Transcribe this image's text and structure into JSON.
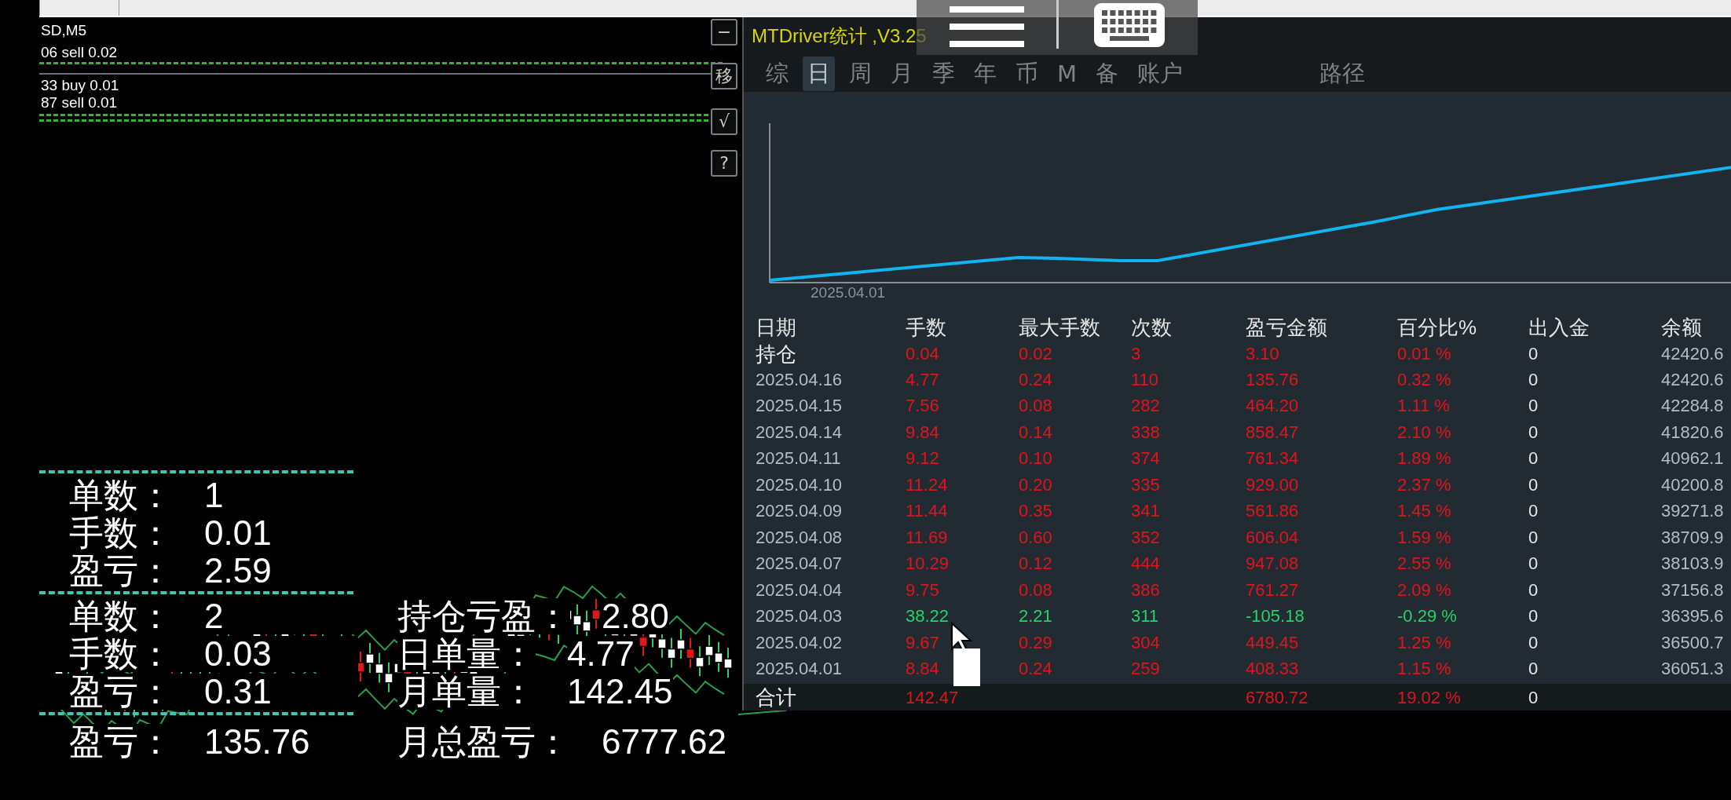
{
  "chart": {
    "symbol": "SD,M5",
    "orders": [
      {
        "label": "06 sell 0.02"
      },
      {
        "label": "33 buy 0.01"
      },
      {
        "label": "87 sell 0.01"
      }
    ],
    "side_buttons": [
      "−",
      "移",
      "√",
      "?"
    ]
  },
  "stats": {
    "group_1": [
      {
        "label": "单数：",
        "value": "1"
      },
      {
        "label": "手数：",
        "value": "0.01"
      },
      {
        "label": "盈亏：",
        "value": "2.59"
      }
    ],
    "group_2": [
      {
        "label": "单数：",
        "value": "2"
      },
      {
        "label": "手数：",
        "value": "0.03"
      },
      {
        "label": "盈亏：",
        "value": "0.31"
      }
    ],
    "group_2_right": [
      {
        "label": "持仓亏盈：",
        "value": "2.80"
      },
      {
        "label": "日单量：",
        "value": "4.77"
      },
      {
        "label": "月单量：",
        "value": "142.45"
      }
    ],
    "totals": [
      {
        "label": "盈亏：",
        "value": "135.76"
      },
      {
        "label": "月总盈亏：",
        "value": "6777.62"
      }
    ]
  },
  "panel": {
    "title": "MTDriver统计 ,V3.25",
    "tabs": [
      {
        "label": "综",
        "selected": false
      },
      {
        "label": "日",
        "selected": true
      },
      {
        "label": "周",
        "selected": false
      },
      {
        "label": "月",
        "selected": false
      },
      {
        "label": "季",
        "selected": false
      },
      {
        "label": "年",
        "selected": false
      },
      {
        "label": "币",
        "selected": false
      },
      {
        "label": "M",
        "selected": false
      },
      {
        "label": "备",
        "selected": false
      },
      {
        "label": "账户",
        "selected": false
      }
    ],
    "path_label": "路径",
    "equity_chart": {
      "date_label": "2025.04.01"
    },
    "table": {
      "columns": [
        "日期",
        "手数",
        "最大手数",
        "次数",
        "盈亏金额",
        "百分比%",
        "出入金",
        "余额"
      ],
      "rows": [
        {
          "kind": "position",
          "date": "持仓",
          "lots": "0.04",
          "max_lots": "0.02",
          "count": "3",
          "pl": "3.10",
          "pct": "0.01 %",
          "flow": "0",
          "balance": "42420.6",
          "loss": false
        },
        {
          "kind": "day",
          "date": "2025.04.16",
          "lots": "4.77",
          "max_lots": "0.24",
          "count": "110",
          "pl": "135.76",
          "pct": "0.32 %",
          "flow": "0",
          "balance": "42420.6",
          "loss": false
        },
        {
          "kind": "day",
          "date": "2025.04.15",
          "lots": "7.56",
          "max_lots": "0.08",
          "count": "282",
          "pl": "464.20",
          "pct": "1.11 %",
          "flow": "0",
          "balance": "42284.8",
          "loss": false
        },
        {
          "kind": "day",
          "date": "2025.04.14",
          "lots": "9.84",
          "max_lots": "0.14",
          "count": "338",
          "pl": "858.47",
          "pct": "2.10 %",
          "flow": "0",
          "balance": "41820.6",
          "loss": false
        },
        {
          "kind": "day",
          "date": "2025.04.11",
          "lots": "9.12",
          "max_lots": "0.10",
          "count": "374",
          "pl": "761.34",
          "pct": "1.89 %",
          "flow": "0",
          "balance": "40962.1",
          "loss": false
        },
        {
          "kind": "day",
          "date": "2025.04.10",
          "lots": "11.24",
          "max_lots": "0.20",
          "count": "335",
          "pl": "929.00",
          "pct": "2.37 %",
          "flow": "0",
          "balance": "40200.8",
          "loss": false
        },
        {
          "kind": "day",
          "date": "2025.04.09",
          "lots": "11.44",
          "max_lots": "0.35",
          "count": "341",
          "pl": "561.86",
          "pct": "1.45 %",
          "flow": "0",
          "balance": "39271.8",
          "loss": false
        },
        {
          "kind": "day",
          "date": "2025.04.08",
          "lots": "11.69",
          "max_lots": "0.60",
          "count": "352",
          "pl": "606.04",
          "pct": "1.59 %",
          "flow": "0",
          "balance": "38709.9",
          "loss": false
        },
        {
          "kind": "day",
          "date": "2025.04.07",
          "lots": "10.29",
          "max_lots": "0.12",
          "count": "444",
          "pl": "947.08",
          "pct": "2.55 %",
          "flow": "0",
          "balance": "38103.9",
          "loss": false
        },
        {
          "kind": "day",
          "date": "2025.04.04",
          "lots": "9.75",
          "max_lots": "0.08",
          "count": "386",
          "pl": "761.27",
          "pct": "2.09 %",
          "flow": "0",
          "balance": "37156.8",
          "loss": false
        },
        {
          "kind": "day",
          "date": "2025.04.03",
          "lots": "38.22",
          "max_lots": "2.21",
          "count": "311",
          "pl": "-105.18",
          "pct": "-0.29 %",
          "flow": "0",
          "balance": "36395.6",
          "loss": true
        },
        {
          "kind": "day",
          "date": "2025.04.02",
          "lots": "9.67",
          "max_lots": "0.29",
          "count": "304",
          "pl": "449.45",
          "pct": "1.25 %",
          "flow": "0",
          "balance": "36500.7",
          "loss": false
        },
        {
          "kind": "day",
          "date": "2025.04.01",
          "lots": "8.84",
          "max_lots": "0.24",
          "count": "259",
          "pl": "408.33",
          "pct": "1.15 %",
          "flow": "0",
          "balance": "36051.3",
          "loss": false
        }
      ],
      "total": {
        "label": "合计",
        "lots": "142.47",
        "pl": "6780.72",
        "pct": "19.02 %",
        "flow": "0"
      }
    }
  }
}
